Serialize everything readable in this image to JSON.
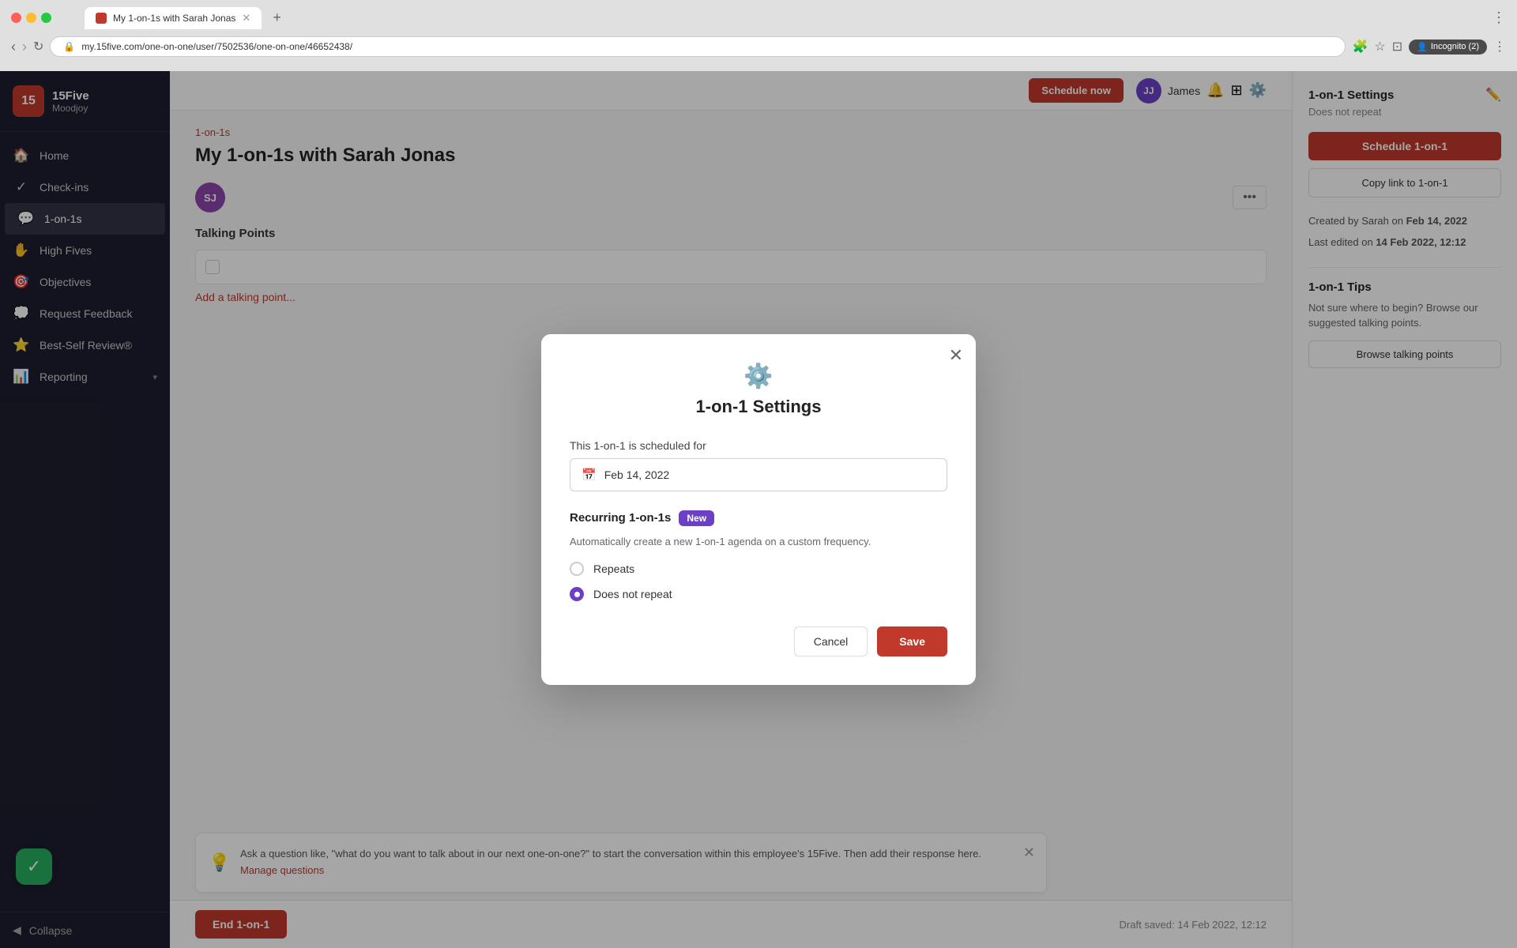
{
  "browser": {
    "tab_title": "My 1-on-1s with Sarah Jonas",
    "url": "my.15five.com/one-on-one/user/7502536/one-on-one/46652438/",
    "incognito_label": "Incognito (2)"
  },
  "sidebar": {
    "app_name": "15Five",
    "app_sub": "Moodjoy",
    "nav_items": [
      {
        "id": "home",
        "label": "Home",
        "icon": "🏠"
      },
      {
        "id": "checkins",
        "label": "Check-ins",
        "icon": "✓"
      },
      {
        "id": "1on1s",
        "label": "1-on-1s",
        "icon": "💬",
        "active": true
      },
      {
        "id": "highfives",
        "label": "High Fives",
        "icon": "✋"
      },
      {
        "id": "objectives",
        "label": "Objectives",
        "icon": "🎯"
      },
      {
        "id": "request-feedback",
        "label": "Request Feedback",
        "icon": "💭"
      },
      {
        "id": "best-self",
        "label": "Best-Self Review®",
        "icon": "⭐"
      },
      {
        "id": "reporting",
        "label": "Reporting",
        "icon": "📊",
        "has_chevron": true
      }
    ],
    "collapse_label": "Collapse"
  },
  "page": {
    "breadcrumb": "1-on-1s",
    "title": "My 1-on-1s with Sarah Jonas",
    "avatar_initials": "SJ",
    "talking_points_label": "Talking Points",
    "add_label": "Add a talking point...",
    "end_btn": "End 1-on-1",
    "draft_status": "Draft saved: 14 Feb 2022, 12:12"
  },
  "right_panel": {
    "settings_title": "1-on-1 Settings",
    "does_not_repeat": "Does not repeat",
    "schedule_btn": "Schedule 1-on-1",
    "copy_link_btn": "Copy link to 1-on-1",
    "created_label": "Created by Sarah on",
    "created_date": "Feb 14, 2022",
    "last_edited_label": "Last edited on",
    "last_edited_date": "14 Feb 2022, 12:12",
    "tips_title": "1-on-1 Tips",
    "tips_text": "Not sure where to begin? Browse our suggested talking points.",
    "browse_btn": "Browse talking points"
  },
  "tip_box": {
    "text": "Ask a question like, \"what do you want to talk about in our next one-on-one?\" to start the conversation within this employee's 15Five. Then add their response here.",
    "link_text": "Manage questions"
  },
  "modal": {
    "title": "1-on-1 Settings",
    "scheduled_label": "This 1-on-1 is scheduled for",
    "date_value": "Feb 14, 2022",
    "recurring_title": "Recurring 1-on-1s",
    "new_badge": "New",
    "recurring_desc": "Automatically create a new 1-on-1 agenda on a custom frequency.",
    "radio_repeats": "Repeats",
    "radio_does_not_repeat": "Does not repeat",
    "cancel_btn": "Cancel",
    "save_btn": "Save"
  },
  "user_header": {
    "initials": "JJ",
    "name": "James"
  }
}
